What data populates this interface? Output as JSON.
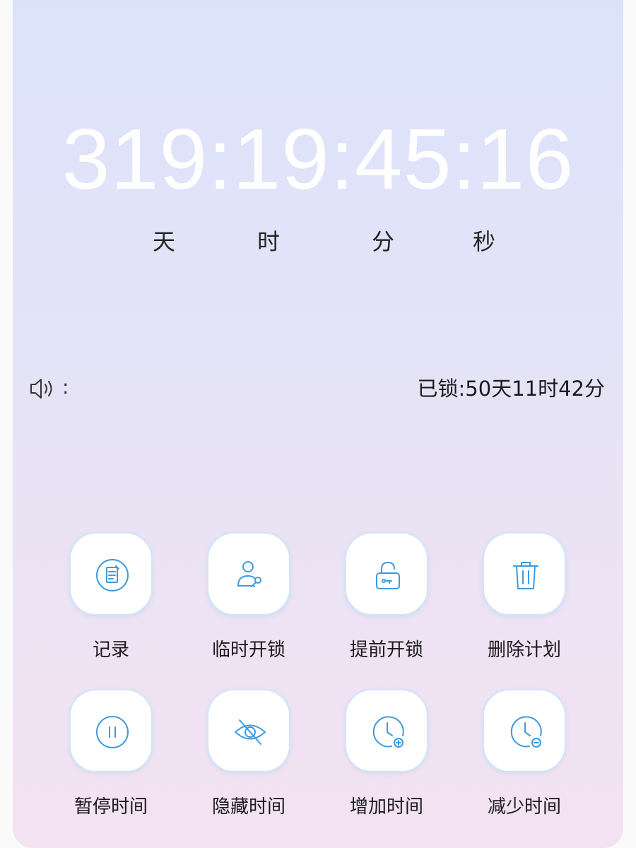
{
  "countdown": {
    "value": "319:19:45:16",
    "units": [
      "天",
      "时",
      "分",
      "秒"
    ]
  },
  "status": {
    "colon": ":",
    "locked_text": "已锁:50天11时42分"
  },
  "actions": [
    {
      "label": "记录",
      "icon": "note-icon"
    },
    {
      "label": "临时开锁",
      "icon": "user-key-icon"
    },
    {
      "label": "提前开锁",
      "icon": "unlock-icon"
    },
    {
      "label": "删除计划",
      "icon": "trash-icon"
    },
    {
      "label": "暂停时间",
      "icon": "pause-icon"
    },
    {
      "label": "隐藏时间",
      "icon": "eye-off-icon"
    },
    {
      "label": "增加时间",
      "icon": "clock-plus-icon"
    },
    {
      "label": "减少时间",
      "icon": "clock-minus-icon"
    }
  ],
  "colors": {
    "accent": "#3d9be0",
    "background_top": "#dbe3fb",
    "background_bottom": "#f3e2f2"
  }
}
